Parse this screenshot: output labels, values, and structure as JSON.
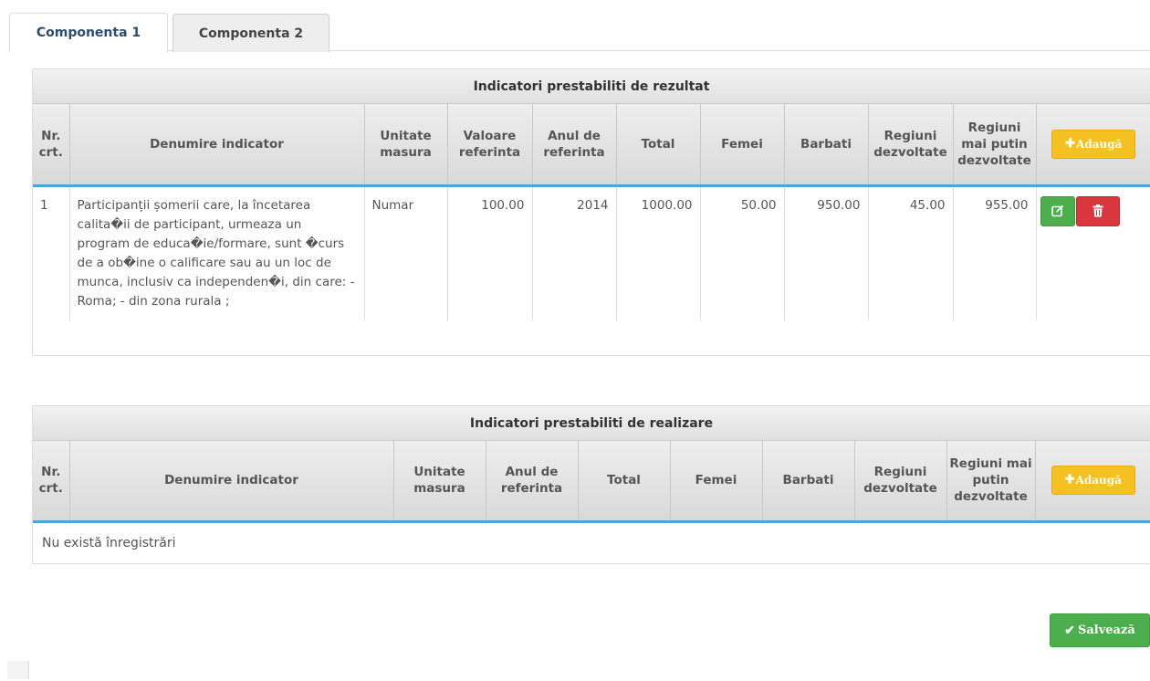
{
  "tabs": [
    {
      "label": "Componenta 1",
      "active": true
    },
    {
      "label": "Componenta 2",
      "active": false
    }
  ],
  "result_table": {
    "caption": "Indicatori prestabiliti de rezultat",
    "headers": [
      "Nr. crt.",
      "Denumire indicator",
      "Unitate masura",
      "Valoare referinta",
      "Anul de referinta",
      "Total",
      "Femei",
      "Barbati",
      "Regiuni dezvoltate",
      "Regiuni mai putin dezvoltate"
    ],
    "add_label": "Adaugă",
    "rows": [
      {
        "nr": "1",
        "denumire": "Participanții șomerii care, la încetarea calita�ii de participant, urmeaza un program de educa�ie/formare, sunt �curs de a ob�ine o calificare sau au un loc de munca, inclusiv ca independen�i, din care: - Roma; - din zona rurala ;",
        "unitate": "Numar",
        "valoare": "100.00",
        "an": "2014",
        "total": "1000.00",
        "femei": "50.00",
        "barbati": "950.00",
        "regiuni_dezv": "45.00",
        "regiuni_mai_putin": "955.00"
      }
    ]
  },
  "realization_table": {
    "caption": "Indicatori prestabiliti de realizare",
    "headers": [
      "Nr. crt.",
      "Denumire indicator",
      "Unitate masura",
      "Anul de referinta",
      "Total",
      "Femei",
      "Barbati",
      "Regiuni dezvoltate",
      "Regiuni mai putin dezvoltate"
    ],
    "add_label": "Adaugă",
    "empty_text": "Nu există înregistrări"
  },
  "save_label": "Salvează",
  "colors": {
    "add_button": "#f5c021",
    "edit_button": "#4cae4c",
    "delete_button": "#d9363e",
    "save_button": "#4cae4c",
    "header_underline": "#4ea4dc"
  }
}
